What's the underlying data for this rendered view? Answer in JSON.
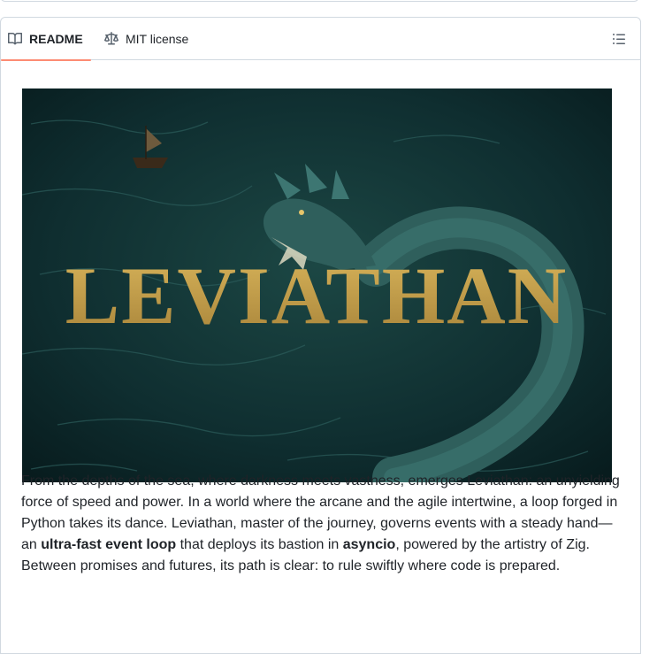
{
  "tabs": [
    {
      "label": "README",
      "icon": "book-icon",
      "active": true
    },
    {
      "label": "MIT license",
      "icon": "law-scale-icon",
      "active": false
    }
  ],
  "toc_icon": "list-unordered-icon",
  "hero": {
    "title": "LEVIATHAN",
    "colors": {
      "background": "#0c2528",
      "title": "#c9a54a",
      "serpent": "#2f5f5c"
    }
  },
  "description": {
    "part1": "From the depths of the sea, where darkness meets vastness, emerges Leviathan: an unyielding force of speed and power. In a world where the arcane and the agile intertwine, a loop forged in Python takes its dance. Leviathan, master of the journey, governs events with a steady hand—an ",
    "bold1": "ultra-fast event loop",
    "part2": " that deploys its bastion in ",
    "bold2": "asyncio",
    "part3": ", powered by the artistry of Zig. Between promises and futures, its path is clear: to rule swiftly where code is prepared."
  },
  "colors": {
    "accent_underline": "#fd8c73",
    "border": "#d1d9e0",
    "text": "#1f2328"
  }
}
